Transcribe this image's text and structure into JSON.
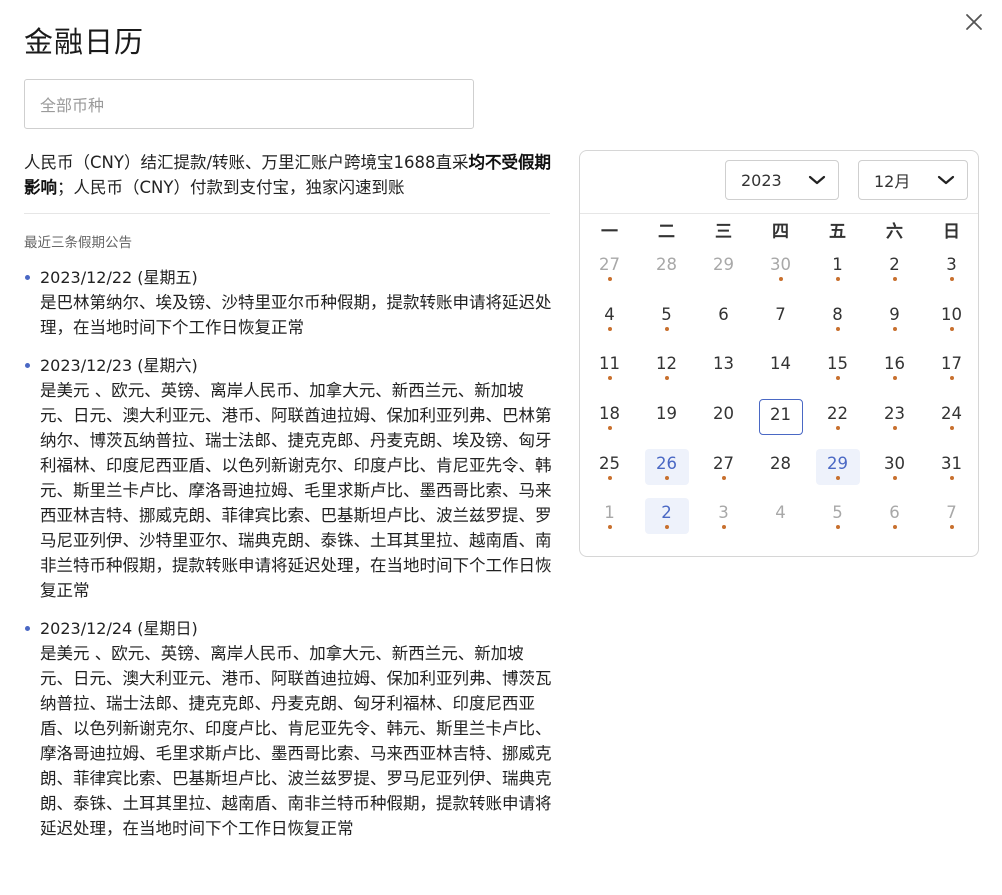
{
  "header": {
    "title": "金融日历",
    "close_icon": "close-icon"
  },
  "currency_select": {
    "placeholder": "全部币种"
  },
  "notice": {
    "part1": "人民币（CNY）结汇提款/转账、万里汇账户跨境宝1688直采",
    "bold": "均不受假期影响",
    "part2": "；人民币（CNY）付款到支付宝，独家闪速到账"
  },
  "announcements": {
    "heading": "最近三条假期公告",
    "items": [
      {
        "date": "2023/12/22 (星期五)",
        "text": "是巴林第纳尔、埃及镑、沙特里亚尔币种假期，提款转账申请将延迟处理，在当地时间下个工作日恢复正常"
      },
      {
        "date": "2023/12/23 (星期六)",
        "text": "是美元 、欧元、英镑、离岸人民币、加拿大元、新西兰元、新加坡元、日元、澳大利亚元、港币、阿联酋迪拉姆、保加利亚列弗、巴林第纳尔、博茨瓦纳普拉、瑞士法郎、捷克克郎、丹麦克朗、埃及镑、匈牙利福林、印度尼西亚盾、以色列新谢克尔、印度卢比、肯尼亚先令、韩元、斯里兰卡卢比、摩洛哥迪拉姆、毛里求斯卢比、墨西哥比索、马来西亚林吉特、挪威克朗、菲律宾比索、巴基斯坦卢比、波兰兹罗提、罗马尼亚列伊、沙特里亚尔、瑞典克朗、泰铢、土耳其里拉、越南盾、南非兰特币种假期，提款转账申请将延迟处理，在当地时间下个工作日恢复正常"
      },
      {
        "date": "2023/12/24 (星期日)",
        "text": "是美元 、欧元、英镑、离岸人民币、加拿大元、新西兰元、新加坡元、日元、澳大利亚元、港币、阿联酋迪拉姆、保加利亚列弗、博茨瓦纳普拉、瑞士法郎、捷克克郎、丹麦克朗、匈牙利福林、印度尼西亚盾、以色列新谢克尔、印度卢比、肯尼亚先令、韩元、斯里兰卡卢比、摩洛哥迪拉姆、毛里求斯卢比、墨西哥比索、马来西亚林吉特、挪威克朗、菲律宾比索、巴基斯坦卢比、波兰兹罗提、罗马尼亚列伊、瑞典克朗、泰铢、土耳其里拉、越南盾、南非兰特币种假期，提款转账申请将延迟处理，在当地时间下个工作日恢复正常"
      }
    ]
  },
  "calendar": {
    "year": "2023",
    "month": "12月",
    "weekdays": [
      "一",
      "二",
      "三",
      "四",
      "五",
      "六",
      "日"
    ],
    "days": [
      {
        "n": "27",
        "other": true,
        "dot": true
      },
      {
        "n": "28",
        "other": true,
        "dot": false
      },
      {
        "n": "29",
        "other": true,
        "dot": false
      },
      {
        "n": "30",
        "other": true,
        "dot": true
      },
      {
        "n": "1",
        "other": false,
        "dot": true
      },
      {
        "n": "2",
        "other": false,
        "dot": true
      },
      {
        "n": "3",
        "other": false,
        "dot": true
      },
      {
        "n": "4",
        "other": false,
        "dot": true
      },
      {
        "n": "5",
        "other": false,
        "dot": true
      },
      {
        "n": "6",
        "other": false,
        "dot": false
      },
      {
        "n": "7",
        "other": false,
        "dot": false
      },
      {
        "n": "8",
        "other": false,
        "dot": true
      },
      {
        "n": "9",
        "other": false,
        "dot": true
      },
      {
        "n": "10",
        "other": false,
        "dot": true
      },
      {
        "n": "11",
        "other": false,
        "dot": true
      },
      {
        "n": "12",
        "other": false,
        "dot": true
      },
      {
        "n": "13",
        "other": false,
        "dot": false
      },
      {
        "n": "14",
        "other": false,
        "dot": false
      },
      {
        "n": "15",
        "other": false,
        "dot": true
      },
      {
        "n": "16",
        "other": false,
        "dot": true
      },
      {
        "n": "17",
        "other": false,
        "dot": true
      },
      {
        "n": "18",
        "other": false,
        "dot": true
      },
      {
        "n": "19",
        "other": false,
        "dot": false
      },
      {
        "n": "20",
        "other": false,
        "dot": false
      },
      {
        "n": "21",
        "other": false,
        "dot": false,
        "today": true
      },
      {
        "n": "22",
        "other": false,
        "dot": true
      },
      {
        "n": "23",
        "other": false,
        "dot": true
      },
      {
        "n": "24",
        "other": false,
        "dot": true
      },
      {
        "n": "25",
        "other": false,
        "dot": true
      },
      {
        "n": "26",
        "other": false,
        "dot": true,
        "highlight": true
      },
      {
        "n": "27",
        "other": false,
        "dot": true
      },
      {
        "n": "28",
        "other": false,
        "dot": false
      },
      {
        "n": "29",
        "other": false,
        "dot": true,
        "highlight": true
      },
      {
        "n": "30",
        "other": false,
        "dot": true
      },
      {
        "n": "31",
        "other": false,
        "dot": true
      },
      {
        "n": "1",
        "other": true,
        "dot": true
      },
      {
        "n": "2",
        "other": false,
        "dot": true,
        "highlight": true
      },
      {
        "n": "3",
        "other": true,
        "dot": true
      },
      {
        "n": "4",
        "other": true,
        "dot": false
      },
      {
        "n": "5",
        "other": true,
        "dot": true
      },
      {
        "n": "6",
        "other": true,
        "dot": true
      },
      {
        "n": "7",
        "other": true,
        "dot": true
      }
    ]
  },
  "colors": {
    "accent": "#4a68c4",
    "dot": "#c8702e",
    "highlight_bg": "#eef2fb"
  }
}
